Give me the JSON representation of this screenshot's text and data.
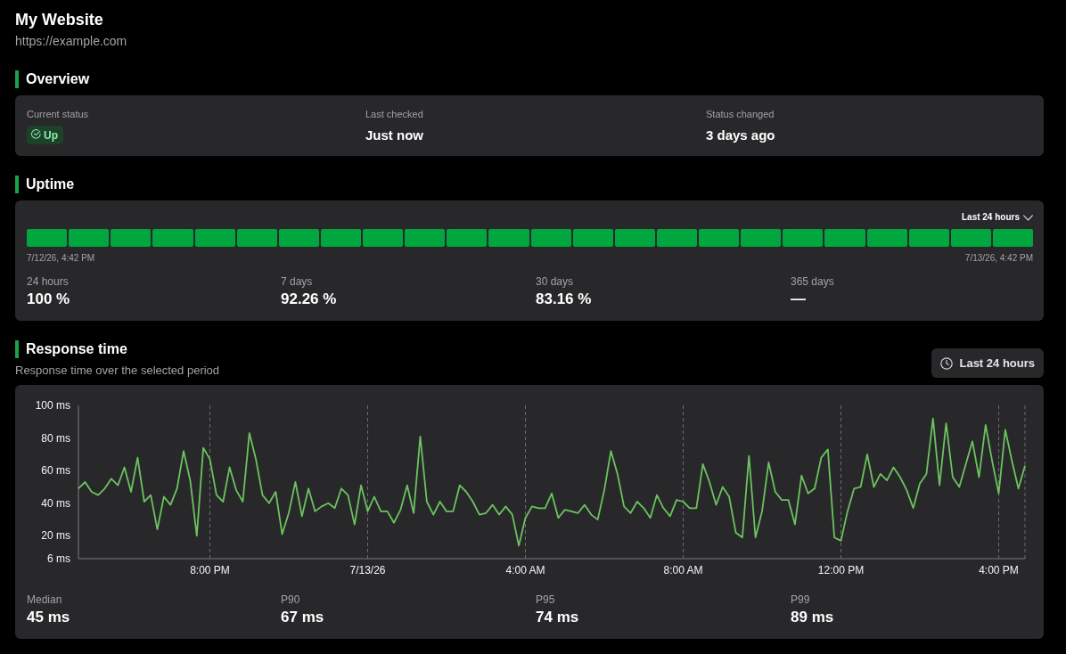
{
  "site": {
    "title": "My Website",
    "url": "https://example.com"
  },
  "overview": {
    "title": "Overview",
    "fields": [
      {
        "kind": "status",
        "label": "Current status",
        "value": "Up",
        "up": true
      },
      {
        "kind": "text",
        "label": "Last checked",
        "value": "Just now"
      },
      {
        "kind": "text",
        "label": "Status changed",
        "value": "3 days ago"
      }
    ]
  },
  "uptime": {
    "title": "Uptime",
    "range": "Last 24 hours",
    "segments": [
      {
        "up": true
      },
      {
        "up": true
      },
      {
        "up": true
      },
      {
        "up": true
      },
      {
        "up": true
      },
      {
        "up": true
      },
      {
        "up": true
      },
      {
        "up": true
      },
      {
        "up": true
      },
      {
        "up": true
      },
      {
        "up": true
      },
      {
        "up": true
      },
      {
        "up": true
      },
      {
        "up": true
      },
      {
        "up": true
      },
      {
        "up": true
      },
      {
        "up": true
      },
      {
        "up": true
      },
      {
        "up": true
      },
      {
        "up": true
      },
      {
        "up": true
      },
      {
        "up": true
      },
      {
        "up": true
      },
      {
        "up": true
      }
    ],
    "start_label": "7/12/26, 4:42 PM",
    "end_label": "7/13/26, 4:42 PM",
    "stats": [
      {
        "label": "24 hours",
        "value": "100 %"
      },
      {
        "label": "7 days",
        "value": "92.26 %"
      },
      {
        "label": "30 days",
        "value": "83.16 %"
      },
      {
        "label": "365 days",
        "value": "—"
      }
    ]
  },
  "response_time": {
    "title": "Response time",
    "subtitle": "Response time over the selected period",
    "range": "Last 24 hours",
    "chart_data": {
      "type": "line",
      "categories": [
        null,
        null,
        null,
        null,
        null,
        null,
        null,
        null,
        null,
        null,
        null,
        null,
        null,
        null,
        null,
        null,
        null,
        null,
        null,
        null,
        "8:00 PM",
        null,
        null,
        null,
        null,
        null,
        null,
        null,
        null,
        null,
        null,
        null,
        null,
        null,
        null,
        null,
        null,
        null,
        null,
        null,
        null,
        null,
        null,
        null,
        "7/13/26",
        null,
        null,
        null,
        null,
        null,
        null,
        null,
        null,
        null,
        null,
        null,
        null,
        null,
        null,
        null,
        null,
        null,
        null,
        null,
        null,
        null,
        null,
        null,
        "4:00 AM",
        null,
        null,
        null,
        null,
        null,
        null,
        null,
        null,
        null,
        null,
        null,
        null,
        null,
        null,
        null,
        null,
        null,
        null,
        null,
        null,
        null,
        null,
        null,
        "8:00 AM",
        null,
        null,
        null,
        null,
        null,
        null,
        null,
        null,
        null,
        null,
        null,
        null,
        null,
        null,
        null,
        null,
        null,
        null,
        null,
        null,
        null,
        null,
        null,
        "12:00 PM",
        null,
        null,
        null,
        null,
        null,
        null,
        null,
        null,
        null,
        null,
        null,
        null,
        null,
        null,
        null,
        null,
        null,
        null,
        null,
        null,
        null,
        null,
        null,
        "4:00 PM",
        null,
        null,
        null,
        null
      ],
      "series": [
        {
          "color": "#6cc35e",
          "values": [
            49,
            53,
            47,
            45,
            49,
            55,
            51,
            62,
            47,
            68,
            41,
            45,
            24,
            44,
            39,
            49,
            72,
            54,
            20,
            74,
            67,
            45,
            41,
            62,
            48,
            41,
            83,
            67,
            45,
            40,
            47,
            21,
            34,
            53,
            32,
            49,
            35,
            38,
            40,
            37,
            49,
            45,
            27,
            51,
            35,
            44,
            35,
            35,
            28,
            36,
            51,
            34,
            81,
            41,
            33,
            41,
            35,
            35,
            51,
            47,
            41,
            33,
            34,
            39,
            33,
            38,
            33,
            14,
            31,
            38,
            37,
            37,
            46,
            31,
            36,
            35,
            34,
            39,
            33,
            30,
            48,
            72,
            58,
            38,
            34,
            41,
            37,
            31,
            45,
            37,
            32,
            42,
            41,
            37,
            37,
            64,
            53,
            39,
            50,
            44,
            22,
            19,
            69,
            19,
            35,
            65,
            47,
            42,
            42,
            27,
            57,
            46,
            49,
            68,
            73,
            19,
            17,
            35,
            49,
            50,
            70,
            50,
            58,
            54,
            62,
            56,
            48,
            37,
            52,
            58,
            92,
            51,
            89,
            56,
            50,
            64,
            78,
            56,
            88,
            66,
            46,
            85,
            66,
            49,
            63
          ]
        }
      ],
      "ylim": [
        6,
        100
      ],
      "yticks": [
        {
          "value": 6,
          "label": "6 ms"
        },
        {
          "value": 20,
          "label": "20 ms"
        },
        {
          "value": 40,
          "label": "40 ms"
        },
        {
          "value": 60,
          "label": "60 ms"
        },
        {
          "value": 80,
          "label": "80 ms"
        },
        {
          "value": 100,
          "label": "100 ms"
        }
      ]
    },
    "stats": [
      {
        "label": "Median",
        "value": "45 ms"
      },
      {
        "label": "P90",
        "value": "67 ms"
      },
      {
        "label": "P95",
        "value": "74 ms"
      },
      {
        "label": "P99",
        "value": "89 ms"
      }
    ]
  }
}
